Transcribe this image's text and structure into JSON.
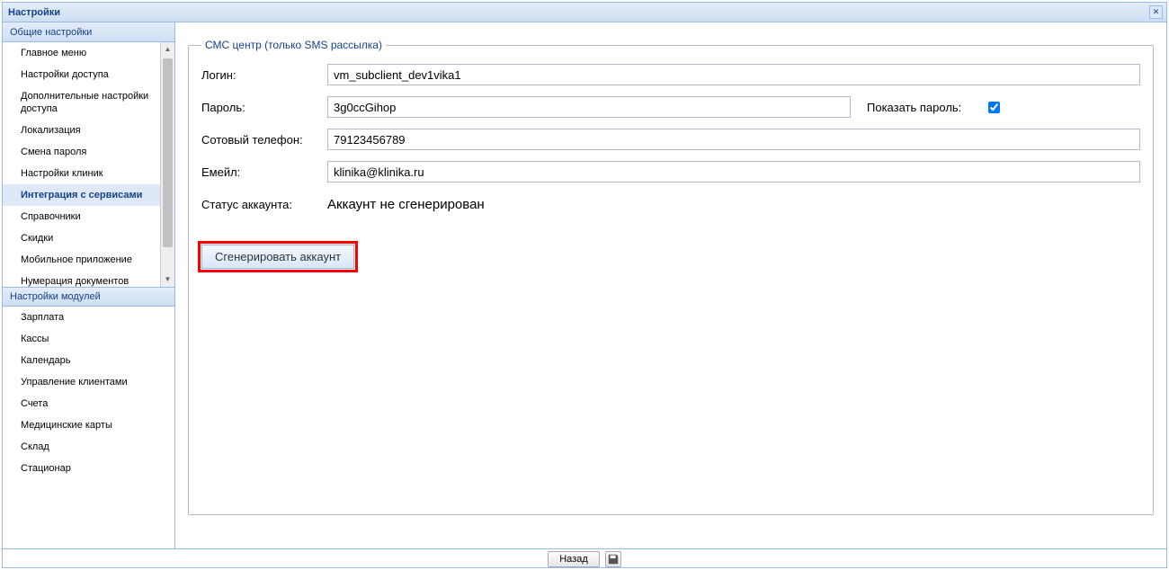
{
  "window": {
    "title": "Настройки"
  },
  "sidebar": {
    "group1": {
      "header": "Общие настройки",
      "items": [
        "Главное меню",
        "Настройки доступа",
        "Дополнительные настройки доступа",
        "Локализация",
        "Смена пароля",
        "Настройки клиник",
        "Интеграция с сервисами",
        "Справочники",
        "Скидки",
        "Мобильное приложение",
        "Нумерация документов"
      ],
      "selected_index": 6
    },
    "group2": {
      "header": "Настройки модулей",
      "items": [
        "Зарплата",
        "Кассы",
        "Календарь",
        "Управление клиентами",
        "Счета",
        "Медицинские карты",
        "Склад",
        "Стационар"
      ]
    }
  },
  "fieldset": {
    "legend": "СМС центр (только SMS рассылка)"
  },
  "form": {
    "login_label": "Логин:",
    "login_value": "vm_subclient_dev1vika1",
    "password_label": "Пароль:",
    "password_value": "3g0ccGihop",
    "show_password_label": "Показать пароль:",
    "show_password_checked": true,
    "phone_label": "Сотовый телефон:",
    "phone_value": "79123456789",
    "email_label": "Емейл:",
    "email_value": "klinika@klinika.ru",
    "status_label": "Статус аккаунта:",
    "status_value": "Аккаунт не сгенерирован",
    "generate_button": "Сгенерировать аккаунт"
  },
  "footer": {
    "back": "Назад"
  }
}
